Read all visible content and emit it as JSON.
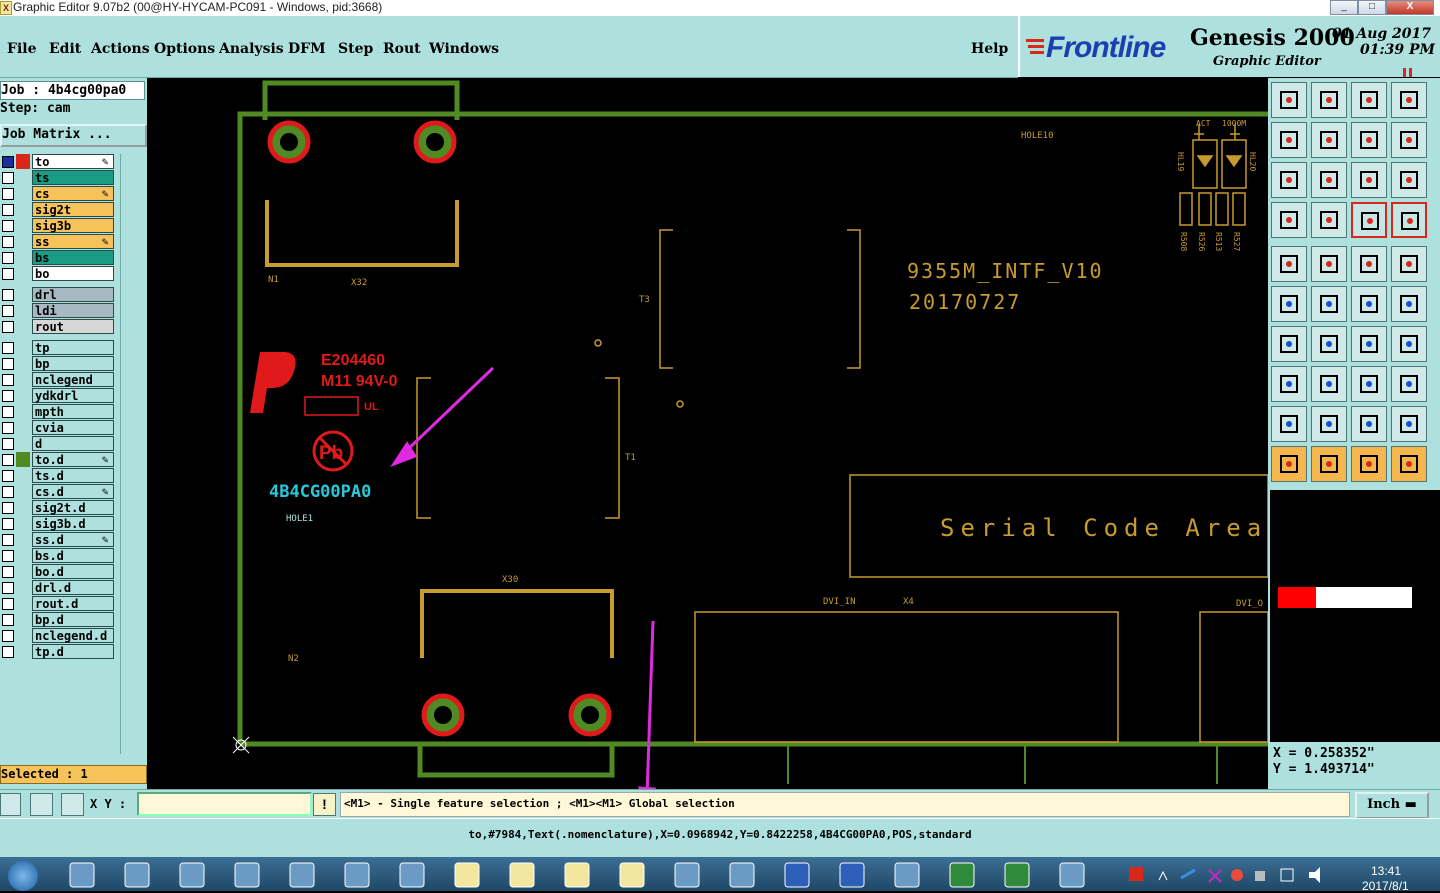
{
  "window": {
    "title": "Graphic Editor 9.07b2 (00@HY-HYCAM-PC091 - Windows, pid:3668)",
    "min": "_",
    "max": "□",
    "close": "X"
  },
  "menu": [
    "File",
    "Edit",
    "Actions",
    "Options",
    "Analysis",
    "DFM",
    "Step",
    "Rout",
    "Windows"
  ],
  "help": "Help",
  "brand": {
    "logo": "Frontline",
    "product": "Genesis 2000",
    "module": "Graphic Editor",
    "date": "01 Aug 2017",
    "time": "01:39 PM"
  },
  "job": {
    "job": "Job : 4b4cg00pa0",
    "step": "Step: cam",
    "matrix": "Job Matrix ..."
  },
  "layers": [
    {
      "name": "to",
      "color": "#ffffff",
      "pen": true
    },
    {
      "name": "ts",
      "color": "#1a9b84"
    },
    {
      "name": "cs",
      "color": "#f5c35a",
      "pen": true
    },
    {
      "name": "sig2t",
      "color": "#f5c35a"
    },
    {
      "name": "sig3b",
      "color": "#f5c35a"
    },
    {
      "name": "ss",
      "color": "#f5c35a",
      "pen": true
    },
    {
      "name": "bs",
      "color": "#1a9b84"
    },
    {
      "name": "bo",
      "color": "#ffffff"
    },
    {
      "name": "drl",
      "color": "#a9b9c4"
    },
    {
      "name": "ldi",
      "color": "#a9b9c4"
    },
    {
      "name": "rout",
      "color": "#d7d7d7"
    },
    {
      "name": "tp",
      "color": "#aee0de"
    },
    {
      "name": "bp",
      "color": "#aee0de"
    },
    {
      "name": "nclegend",
      "color": "#aee0de"
    },
    {
      "name": "ydkdrl",
      "color": "#aee0de"
    },
    {
      "name": "mpth",
      "color": "#aee0de"
    },
    {
      "name": "cvia",
      "color": "#aee0de"
    },
    {
      "name": "d",
      "color": "#aee0de"
    },
    {
      "name": "to.d",
      "color": "#aee0de",
      "pen": true
    },
    {
      "name": "ts.d",
      "color": "#aee0de"
    },
    {
      "name": "cs.d",
      "color": "#aee0de",
      "pen": true
    },
    {
      "name": "sig2t.d",
      "color": "#aee0de"
    },
    {
      "name": "sig3b.d",
      "color": "#aee0de"
    },
    {
      "name": "ss.d",
      "color": "#aee0de",
      "pen": true
    },
    {
      "name": "bs.d",
      "color": "#aee0de"
    },
    {
      "name": "bo.d",
      "color": "#aee0de"
    },
    {
      "name": "drl.d",
      "color": "#aee0de"
    },
    {
      "name": "rout.d",
      "color": "#aee0de"
    },
    {
      "name": "bp.d",
      "color": "#aee0de"
    },
    {
      "name": "nclegend.d",
      "color": "#aee0de"
    },
    {
      "name": "tp.d",
      "color": "#aee0de"
    }
  ],
  "selected": "Selected : 1",
  "board": {
    "labels": {
      "n1": "N1",
      "x32": "X32",
      "hole10": "HOLE10",
      "t3": "T3",
      "t1": "T1",
      "hole1": "HOLE1",
      "x30": "X30",
      "n2": "N2",
      "dvi_in": "DVI_IN",
      "x4": "X4",
      "dvi_right": "DVI_O",
      "act": "ACT",
      "r1000": "1000M",
      "hl19": "HL19",
      "hl20": "HL20",
      "r508": "R508",
      "r526": "R526",
      "r513": "R513",
      "r527": "R527"
    },
    "board_name": "9355M_INTF_V10",
    "board_date": "20170727",
    "ul_code": "E204460",
    "ul_rating": "M11 94V-0",
    "pb": "Pb",
    "selected_text": "4B4CG00PA0",
    "serial_area": "Serial Code Area"
  },
  "coords": {
    "x": "X = 0.258352\"",
    "y": "Y = 1.493714\""
  },
  "cmd": {
    "xy_label": "X Y :",
    "xy_value": "",
    "hint": "<M1> - Single feature selection ; <M1><M1> Global selection",
    "units": "Inch"
  },
  "status": "to,#7984,Text(.nomenclature),X=0.0968942,Y=0.8422258,4B4CG00PA0,POS,standard",
  "clock": {
    "time": "13:41",
    "date": "2017/8/1"
  },
  "colors": {
    "teal_bg": "#aee0de",
    "copper_green": "#4f8a23",
    "pad_red": "#e01a1a",
    "silk_yellow": "#c89b2e",
    "annotation_magenta": "#e02ae0"
  }
}
